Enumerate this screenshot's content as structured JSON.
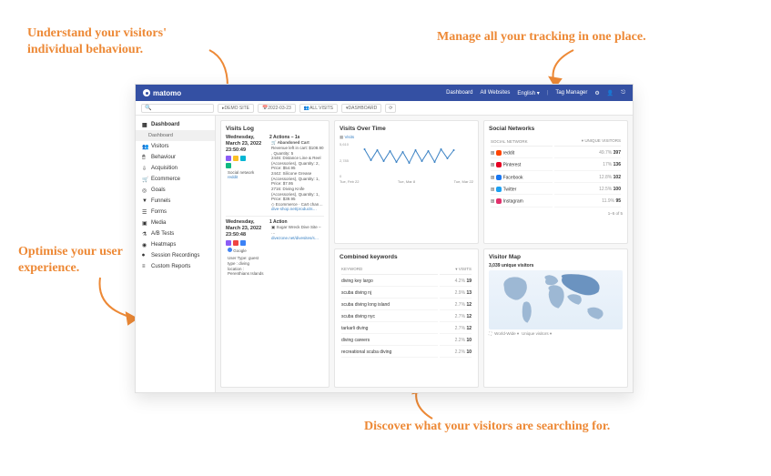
{
  "annotations": {
    "a1": "Understand your visitors' individual behaviour.",
    "a2": "Manage all your tracking in one place.",
    "a3": "Optimise your user experience.",
    "a4": "Discover what your visitors are searching for."
  },
  "topbar": {
    "brand": "matomo",
    "nav": [
      "Dashboard",
      "All Websites",
      "English"
    ],
    "tagmgr": "Tag Manager"
  },
  "toolbar": {
    "site": "DEMO SITE",
    "date": "2022-03-23",
    "segment": "ALL VISITS",
    "dash": "DASHBOARD"
  },
  "sidebar": {
    "items": [
      {
        "label": "Dashboard",
        "bold": true
      },
      {
        "label": "Dashboard",
        "sub": true
      },
      {
        "label": "Visitors"
      },
      {
        "label": "Behaviour"
      },
      {
        "label": "Acquisition"
      },
      {
        "label": "Ecommerce"
      },
      {
        "label": "Goals"
      },
      {
        "label": "Funnels"
      },
      {
        "label": "Forms"
      },
      {
        "label": "Media"
      },
      {
        "label": "A/B Tests"
      },
      {
        "label": "Heatmaps"
      },
      {
        "label": "Session Recordings"
      },
      {
        "label": "Custom Reports"
      }
    ]
  },
  "visits_log": {
    "title": "Visits Log",
    "entries": [
      {
        "date": "Wednesday, March 23, 2022 23:50:49",
        "actions_title": "2 Actions – 1s",
        "lines": [
          "Abandoned Cart",
          "Revenue left in cart: $108.90 , Quantity: 5",
          "2446: Distance Line & Reel (Accessories), Quantity: 2, Price: $54.95",
          "2442: Silicone Grease (Accessories), Quantity: 1, Price: $7.95",
          "2716: Diving Knife (Accessories), Quantity: 1, Price: $39.95"
        ],
        "ecomm": "Ecommerce · Cart chan…",
        "ecomm_link": "dive-shop.net/products…",
        "social_label": "Social network",
        "social_value": "reddit"
      },
      {
        "date": "Wednesday, March 23, 2022 23:50:48",
        "actions_title": "1 Action",
        "lines": [
          "Sugar Wreck Dive Site – …"
        ],
        "site_link": "divezone.net/divesites/s…",
        "referrer": "Google",
        "user_type_label": "User Type:",
        "user_type": "guest",
        "type_label": "type :",
        "type": "diving",
        "loc_label": "location :",
        "loc": "Perenthians Islands"
      }
    ]
  },
  "visits_over_time": {
    "title": "Visits Over Time",
    "legend": "Visits",
    "y_ticks": [
      "5,610",
      "2,785",
      "0"
    ],
    "x_ticks": [
      "Tue, Feb 22",
      "Tue, Mar 8",
      "Tue, Mar 22"
    ]
  },
  "chart_data": {
    "type": "line",
    "title": "Visits Over Time",
    "xlabel": "",
    "ylabel": "Visits",
    "ylim": [
      0,
      5610
    ],
    "x": [
      "Feb 22",
      "Feb 24",
      "Feb 26",
      "Feb 28",
      "Mar 2",
      "Mar 4",
      "Mar 6",
      "Mar 8",
      "Mar 10",
      "Mar 12",
      "Mar 14",
      "Mar 16",
      "Mar 18",
      "Mar 20",
      "Mar 22"
    ],
    "series": [
      {
        "name": "Visits",
        "values": [
          5000,
          3400,
          4800,
          3300,
          4700,
          3200,
          4500,
          3100,
          4800,
          3300,
          4600,
          3200,
          4900,
          3600,
          4700
        ]
      }
    ]
  },
  "combined_keywords": {
    "title": "Combined keywords",
    "col1": "KEYWORD",
    "col2": "VISITS",
    "rows": [
      {
        "k": "diving key largo",
        "p": "4.2%",
        "v": "19"
      },
      {
        "k": "scuba diving nj",
        "p": "2.9%",
        "v": "13"
      },
      {
        "k": "scuba diving long island",
        "p": "2.7%",
        "v": "12"
      },
      {
        "k": "scuba diving nyc",
        "p": "2.7%",
        "v": "12"
      },
      {
        "k": "tarkarli diving",
        "p": "2.7%",
        "v": "12"
      },
      {
        "k": "diving careers",
        "p": "2.2%",
        "v": "10"
      },
      {
        "k": "recreational scuba diving",
        "p": "2.2%",
        "v": "10"
      }
    ]
  },
  "social_networks": {
    "title": "Social Networks",
    "col1": "SOCIAL NETWORK",
    "col2": "UNIQUE VISITORS",
    "rows": [
      {
        "n": "reddit",
        "p": "49.7%",
        "v": "397",
        "c": "#ff4500"
      },
      {
        "n": "Pinterest",
        "p": "17%",
        "v": "136",
        "c": "#e60023"
      },
      {
        "n": "Facebook",
        "p": "12.8%",
        "v": "102",
        "c": "#1877f2"
      },
      {
        "n": "Twitter",
        "p": "12.5%",
        "v": "100",
        "c": "#1da1f2"
      },
      {
        "n": "Instagram",
        "p": "11.9%",
        "v": "95",
        "c": "#e1306c"
      }
    ],
    "footer": "1–5 of 5"
  },
  "visitor_map": {
    "title": "Visitor Map",
    "count": "3,039 unique visitors",
    "region": "World-Wide",
    "metric": "Unique visitors"
  }
}
